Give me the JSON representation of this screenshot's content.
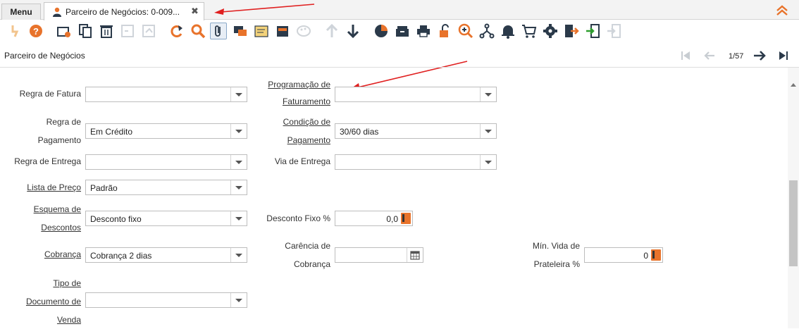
{
  "tabs": {
    "menu_label": "Menu",
    "document_label": "Parceiro de Negócios: 0-009...",
    "close_glyph": "✖"
  },
  "toolbar": {
    "icons": [
      "undo-icon",
      "help-icon",
      "new-record-icon",
      "copy-record-icon",
      "delete-icon",
      "save-icon",
      "save-new-icon",
      "refresh-icon",
      "find-icon",
      "attachment-icon",
      "chat-icon",
      "notes-icon",
      "history-icon",
      "palette-icon",
      "parent-record-icon",
      "detail-record-icon",
      "report-icon",
      "archive-icon",
      "print-icon",
      "lock-icon",
      "zoom-across-icon",
      "workflow-icon",
      "notification-icon",
      "product-info-icon",
      "process-icon",
      "export-icon",
      "import-icon",
      "logout-icon"
    ]
  },
  "header": {
    "title": "Parceiro de Negócios",
    "page_count": "1/57"
  },
  "form": {
    "regra_fatura": {
      "label": "Regra de Fatura",
      "value": ""
    },
    "programacao_faturamento": {
      "label_line1": "Programação de",
      "label_line2": "Faturamento",
      "value": ""
    },
    "regra_pagamento": {
      "label_line1": "Regra de",
      "label_line2": "Pagamento",
      "value": "Em Crédito"
    },
    "condicao_pagamento": {
      "label_line1": "Condição de",
      "label_line2": "Pagamento",
      "value": "30/60 dias"
    },
    "regra_entrega": {
      "label": "Regra de Entrega",
      "value": ""
    },
    "via_entrega": {
      "label": "Via de Entrega",
      "value": ""
    },
    "lista_preco": {
      "label": "Lista de Preço",
      "value": "Padrão"
    },
    "esquema_descontos": {
      "label_line1": "Esquema de",
      "label_line2": "Descontos",
      "value": "Desconto fixo"
    },
    "desconto_fixo": {
      "label": "Desconto Fixo %",
      "value": "0,0"
    },
    "cobranca": {
      "label": "Cobrança",
      "value": "Cobrança 2 dias"
    },
    "carencia_cobranca": {
      "label_line1": "Carência de",
      "label_line2": "Cobrança",
      "value": ""
    },
    "min_vida_prateleira": {
      "label_line1": "Mín. Vida de",
      "label_line2": "Prateleira %",
      "value": "0"
    },
    "tipo_documento_venda": {
      "label_line1": "Tipo de",
      "label_line2": "Documento de",
      "label_line3": "Venda",
      "value": ""
    }
  },
  "colors": {
    "accent_orange": "#e8732b",
    "annotation_red": "#e02020",
    "icon_dark": "#2b3a4a"
  }
}
